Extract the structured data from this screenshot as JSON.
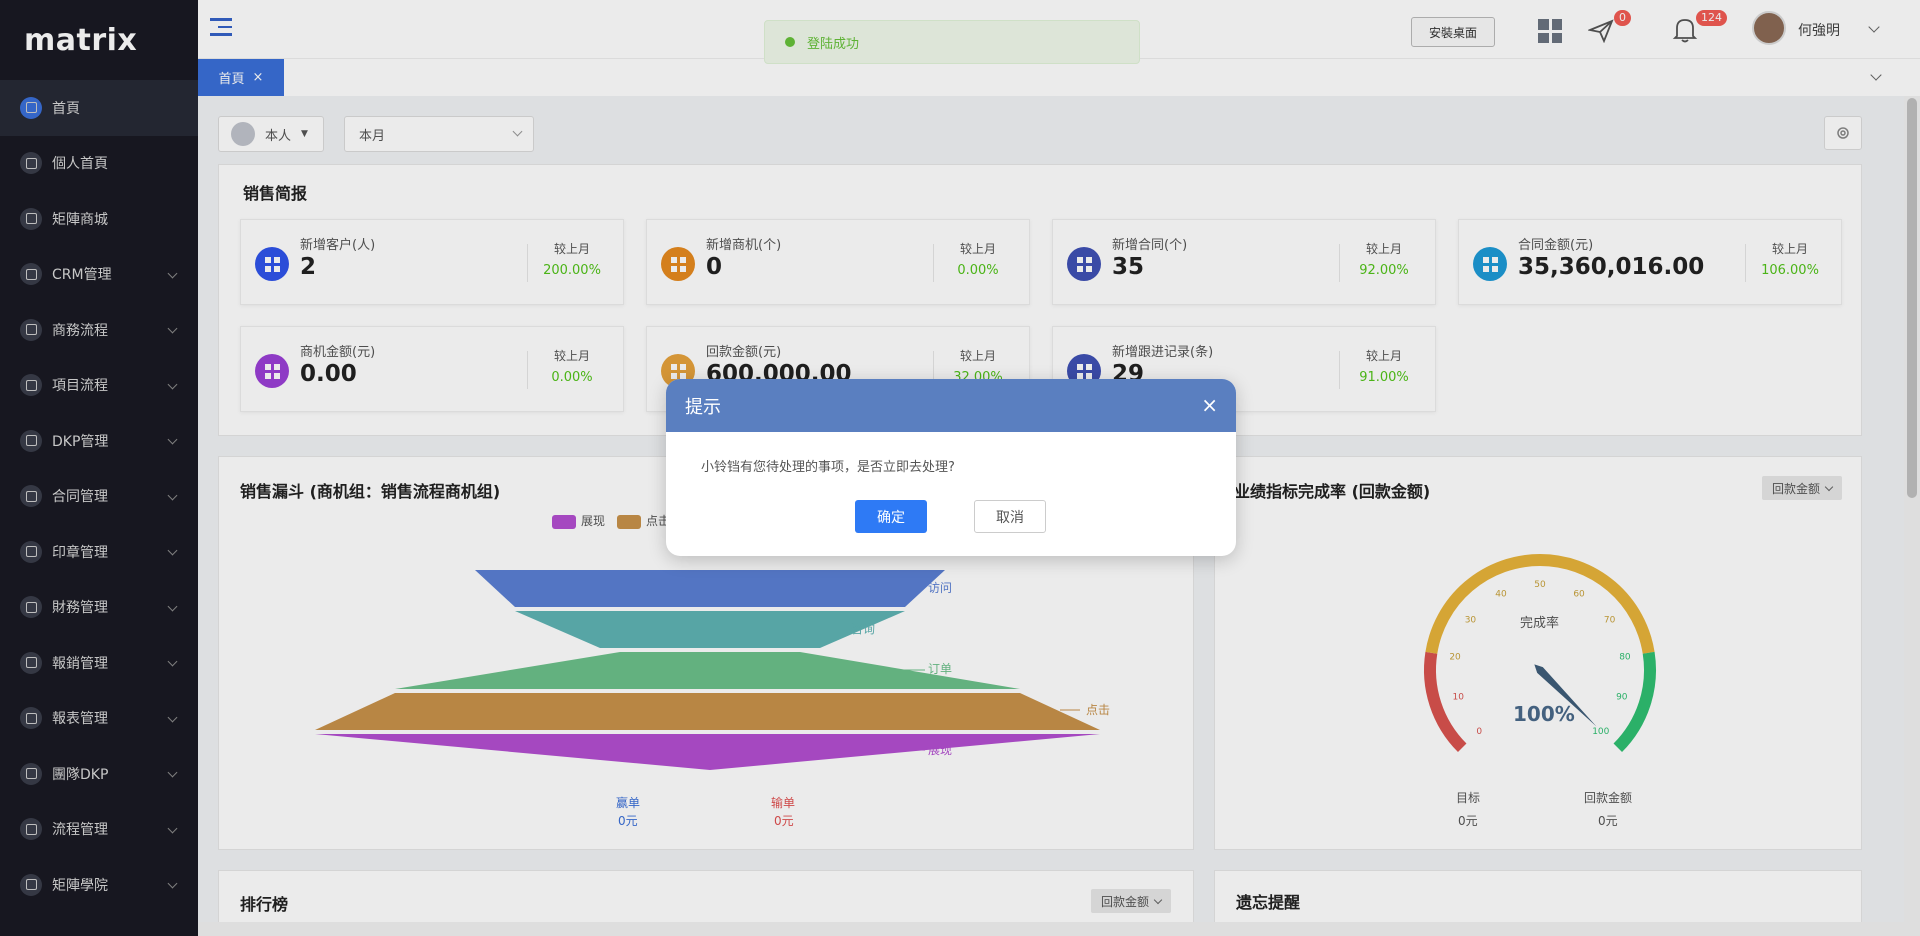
{
  "app": {
    "logo": "matrix"
  },
  "sidebar": {
    "items": [
      {
        "label": "首頁",
        "has_children": false
      },
      {
        "label": "個人首頁",
        "has_children": false
      },
      {
        "label": "矩陣商城",
        "has_children": false
      },
      {
        "label": "CRM管理",
        "has_children": true
      },
      {
        "label": "商務流程",
        "has_children": true
      },
      {
        "label": "項目流程",
        "has_children": true
      },
      {
        "label": "DKP管理",
        "has_children": true
      },
      {
        "label": "合同管理",
        "has_children": true
      },
      {
        "label": "印章管理",
        "has_children": true
      },
      {
        "label": "財務管理",
        "has_children": true
      },
      {
        "label": "報銷管理",
        "has_children": true
      },
      {
        "label": "報表管理",
        "has_children": true
      },
      {
        "label": "團隊DKP",
        "has_children": true
      },
      {
        "label": "流程管理",
        "has_children": true
      },
      {
        "label": "矩陣學院",
        "has_children": true
      }
    ]
  },
  "header": {
    "install_label": "安裝桌面",
    "message_badge": "0",
    "notification_badge": "124",
    "username": "何強明"
  },
  "toast": {
    "text": "登陆成功"
  },
  "tabs": [
    {
      "label": "首頁",
      "close": "×"
    }
  ],
  "filters": {
    "owner": "本人",
    "period": "本月"
  },
  "sales": {
    "title": "销售简报",
    "compare_label": "较上月",
    "cards": [
      {
        "label": "新增客户(人)",
        "value": "2",
        "pct": "200.00%",
        "color": "#2f54eb"
      },
      {
        "label": "新增商机(个)",
        "value": "0",
        "pct": "0.00%",
        "color": "#e68a1f"
      },
      {
        "label": "新增合同(个)",
        "value": "35",
        "pct": "92.00%",
        "color": "#3f51b5"
      },
      {
        "label": "合同金额(元)",
        "value": "35,360,016.00",
        "pct": "106.00%",
        "color": "#1e9bd7"
      },
      {
        "label": "商机金额(元)",
        "value": "0.00",
        "pct": "0.00%",
        "color": "#9b3fd6"
      },
      {
        "label": "回款金额(元)",
        "value": "600,000.00",
        "pct": "32.00%",
        "color": "#e6a23c"
      },
      {
        "label": "新增跟进记录(条)",
        "value": "29",
        "pct": "91.00%",
        "color": "#3f51b5"
      }
    ]
  },
  "funnel": {
    "title": "销售漏斗 (商机组：销售流程商机组)",
    "legend": [
      {
        "label": "展现",
        "color": "#b34fd1"
      },
      {
        "label": "点击",
        "color": "#c8924a"
      }
    ],
    "stages": [
      "访问",
      "咨询",
      "订单",
      "点击",
      "展现"
    ],
    "win_label": "赢单",
    "win_value": "0元",
    "lose_label": "输单",
    "lose_value": "0元"
  },
  "gauge": {
    "title": "业绩指标完成率 (回款金额)",
    "dropdown": "回款金额",
    "center_label": "完成率",
    "value_text": "100%",
    "value": 100,
    "ticks": [
      "0",
      "10",
      "20",
      "30",
      "40",
      "50",
      "60",
      "70",
      "80",
      "90",
      "100"
    ],
    "target_label": "目标",
    "target_value": "0元",
    "collection_label": "回款金额",
    "collection_value": "0元"
  },
  "ranking": {
    "title": "排行榜",
    "dropdown": "回款金额"
  },
  "reminder": {
    "title": "遗忘提醒"
  },
  "dialog": {
    "title": "提示",
    "message": "小铃铛有您待处理的事项，是否立即去处理?",
    "confirm": "确定",
    "cancel": "取消",
    "close": "×"
  },
  "colors": {
    "sidebar_bg": "#191a23",
    "accent": "#3a6fd8",
    "success": "#52c41a",
    "dialog_header": "#5a7fc0"
  }
}
